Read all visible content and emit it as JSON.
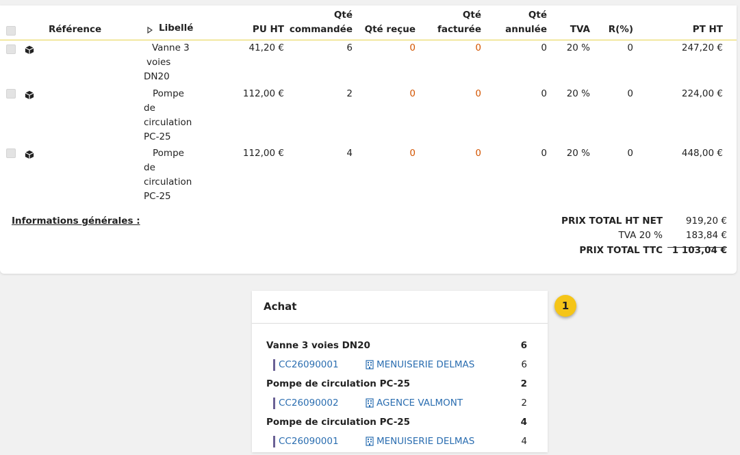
{
  "table": {
    "headers": {
      "reference": "Référence",
      "libelle": "Libellé",
      "pu_ht": "PU HT",
      "qte_commandee_1": "Qté",
      "qte_commandee_2": "commandée",
      "qte_recue": "Qté reçue",
      "qte_facturee_1": "Qté",
      "qte_facturee_2": "facturée",
      "qte_annulee_1": "Qté",
      "qte_annulee_2": "annulée",
      "tva": "TVA",
      "remise": "R(%)",
      "pt_ht": "PT HT"
    },
    "rows": [
      {
        "libelle_lines": [
          "Vanne 3",
          "voies",
          "DN20"
        ],
        "pu_ht": "41,20 €",
        "qte_commandee": "6",
        "qte_recue": "0",
        "qte_facturee": "0",
        "qte_annulee": "0",
        "tva": "20 %",
        "remise": "0",
        "pt_ht": "247,20 €"
      },
      {
        "libelle_lines": [
          "Pompe",
          "de",
          "circulation",
          "PC-25"
        ],
        "pu_ht": "112,00 €",
        "qte_commandee": "2",
        "qte_recue": "0",
        "qte_facturee": "0",
        "qte_annulee": "0",
        "tva": "20 %",
        "remise": "0",
        "pt_ht": "224,00 €"
      },
      {
        "libelle_lines": [
          "Pompe",
          "de",
          "circulation",
          "PC-25"
        ],
        "pu_ht": "112,00 €",
        "qte_commandee": "4",
        "qte_recue": "0",
        "qte_facturee": "0",
        "qte_annulee": "0",
        "tva": "20 %",
        "remise": "0",
        "pt_ht": "448,00 €"
      }
    ]
  },
  "info_link": "Informations générales :",
  "totals": {
    "ht_net_label": "PRIX TOTAL HT NET",
    "ht_net_value": "919,20 €",
    "tva_label": "TVA 20 %",
    "tva_value": "183,84 €",
    "ttc_label": "PRIX TOTAL TTC",
    "ttc_value": "1 103,04 €"
  },
  "achat": {
    "title": "Achat",
    "groups": [
      {
        "product": "Vanne 3 voies DN20",
        "qty": "6",
        "order": "CC26090001",
        "supplier": "MENUISERIE DELMAS",
        "order_qty": "6"
      },
      {
        "product": "Pompe de circulation PC-25",
        "qty": "2",
        "order": "CC26090002",
        "supplier": "AGENCE VALMONT",
        "order_qty": "2"
      },
      {
        "product": "Pompe de circulation PC-25",
        "qty": "4",
        "order": "CC26090001",
        "supplier": "MENUISERIE DELMAS",
        "order_qty": "4"
      }
    ]
  },
  "badge": "1",
  "colors": {
    "accent_line": "#e6d24a",
    "zero_qty": "#d35400",
    "link": "#2a6db0",
    "badge": "#f5c518"
  }
}
